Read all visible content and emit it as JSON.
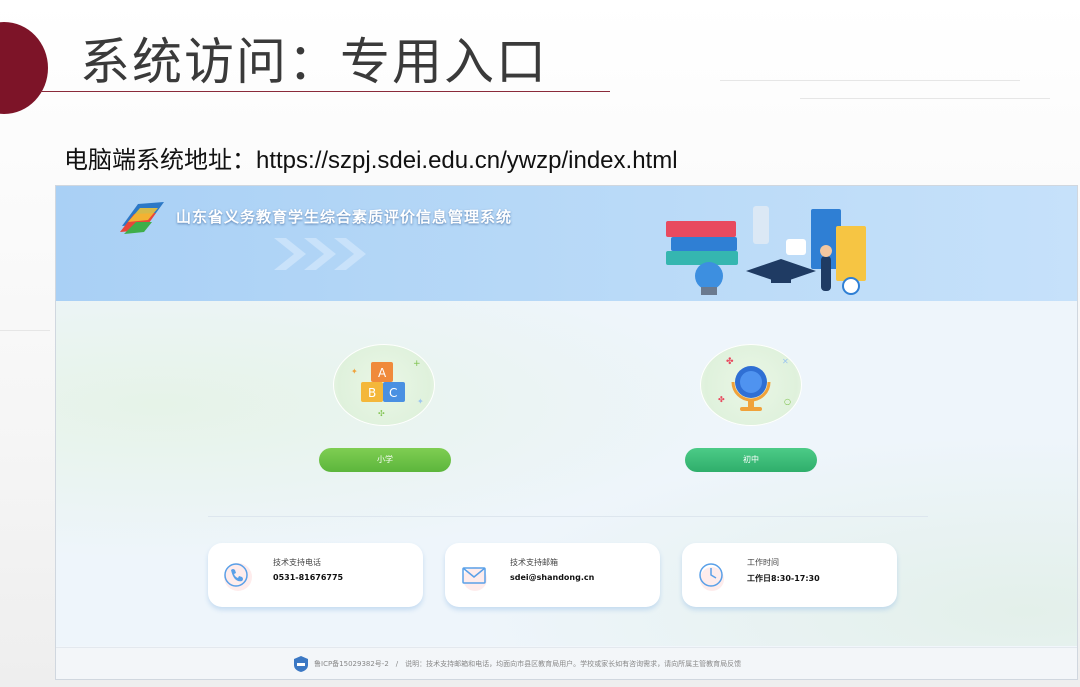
{
  "slide": {
    "title": "系统访问：专用入口",
    "url_line": "电脑端系统地址：https://szpj.sdei.edu.cn/ywzp/index.html"
  },
  "app": {
    "system_title": "山东省义务教育学生综合素质评价信息管理系统",
    "entries": [
      {
        "label": "小学",
        "icon": "abc-blocks-icon"
      },
      {
        "label": "初中",
        "icon": "globe-icon"
      }
    ],
    "contacts": [
      {
        "label": "技术支持电话",
        "value": "0531-81676775",
        "icon": "phone-icon"
      },
      {
        "label": "技术支持邮箱",
        "value": "sdei@shandong.cn",
        "icon": "mail-icon"
      },
      {
        "label": "工作时间",
        "value": "工作日8:30-17:30",
        "icon": "clock-icon"
      }
    ],
    "footer": "鲁ICP备15029382号-2　/　说明：技术支持邮箱和电话，均面向市县区教育局用户。学校或家长如有咨询需求，请向所属主管教育局反馈"
  },
  "colors": {
    "accent_dark_red": "#7d1428",
    "primary_button": "#6cc147",
    "middle_button": "#3dbb78",
    "header_blue": "#b6d8f7"
  }
}
